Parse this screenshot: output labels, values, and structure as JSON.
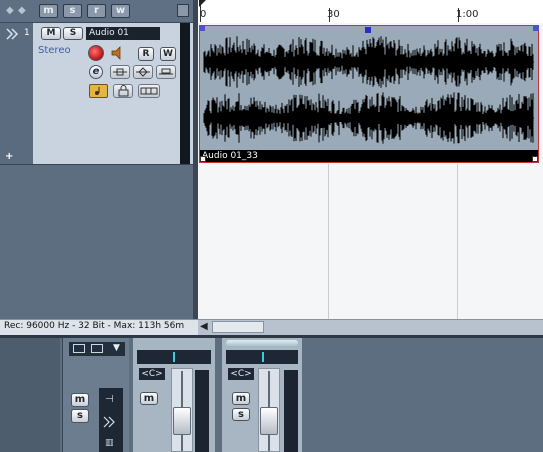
{
  "toolbar": {
    "global_buttons": [
      "m",
      "s",
      "r",
      "w"
    ]
  },
  "track": {
    "number": "1",
    "name": "Audio 01",
    "channel_type": "Stereo",
    "mute_label": "M",
    "solo_label": "S",
    "read_label": "R",
    "write_label": "W",
    "edit_label": "e",
    "add_marker": "+"
  },
  "ruler": {
    "labels": [
      "0",
      "30",
      "1:00"
    ]
  },
  "event": {
    "name": "Audio 01_33"
  },
  "status": {
    "text": "Rec: 96000 Hz - 32 Bit - Max: 113h 56m"
  },
  "mixer": {
    "channels": [
      {
        "pan_label": "<C>",
        "mute_label": "m",
        "solo_label": "s"
      },
      {
        "pan_label": "<C>",
        "mute_label": "m",
        "solo_label": "s"
      }
    ],
    "common_mute": "m",
    "common_solo": "s"
  },
  "colors": {
    "panel_bg": "#5d6e80",
    "track_bg": "#c8d3df",
    "event_bg": "#9aaab9",
    "waveform": "#000000",
    "project_bg": "#f4f6f8",
    "record_red": "#c81e1e"
  }
}
